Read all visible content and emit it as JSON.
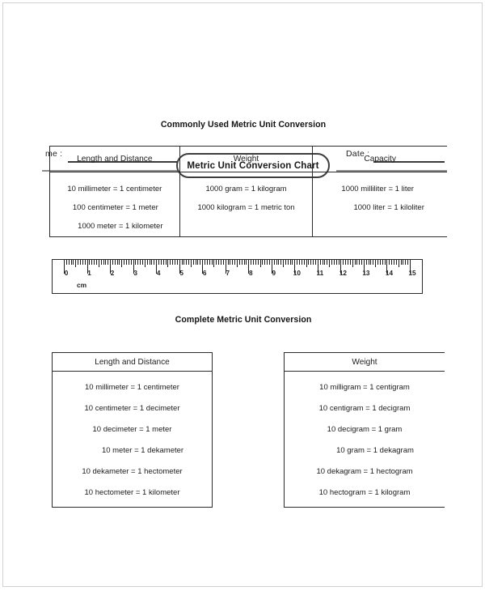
{
  "header": {
    "name_label": "me :",
    "date_label": "Date :",
    "title": "Metric Unit Conversion Chart"
  },
  "sections": {
    "commonly_used_heading": "Commonly Used Metric Unit Conversion",
    "complete_heading": "Complete Metric Unit Conversion"
  },
  "commonly_used_table": {
    "headers": [
      "Length and Distance",
      "Weight",
      "Capacity"
    ],
    "columns": [
      [
        "10 millimeter = 1 centimeter",
        "100 centimeter = 1 meter",
        "1000 meter = 1 kilometer"
      ],
      [
        "1000 gram = 1 kilogram",
        "1000 kilogram = 1 metric ton"
      ],
      [
        "1000 milliliter = 1 liter",
        "1000 liter = 1 kiloliter"
      ]
    ]
  },
  "ruler": {
    "unit_label": "cm",
    "min": 0,
    "max": 15,
    "numbers": [
      "0",
      "1",
      "2",
      "3",
      "4",
      "5",
      "6",
      "7",
      "8",
      "9",
      "10",
      "11",
      "12",
      "13",
      "14",
      "15"
    ],
    "minor_divisions_per_unit": 10
  },
  "complete_tables": [
    {
      "header": "Length and Distance",
      "rows": [
        "10 millimeter = 1 centimeter",
        "10 centimeter = 1 decimeter",
        "10 decimeter = 1 meter",
        "10 meter =  1 dekameter",
        "10 dekameter = 1 hectometer",
        "10 hectometer = 1 kilometer"
      ]
    },
    {
      "header": "Weight",
      "rows": [
        "10 milligram = 1 centigram",
        "10 centigram = 1 decigram",
        "10 decigram = 1 gram",
        "10 gram =  1 dekagram",
        "10 dekagram = 1 hectogram",
        "10 hectogram = 1 kilogram"
      ]
    }
  ],
  "colors": {
    "ink": "#1a1a1a",
    "border": "#2b2b2b",
    "rule": "#8c8c8c",
    "page_border": "#d2d2d2"
  }
}
